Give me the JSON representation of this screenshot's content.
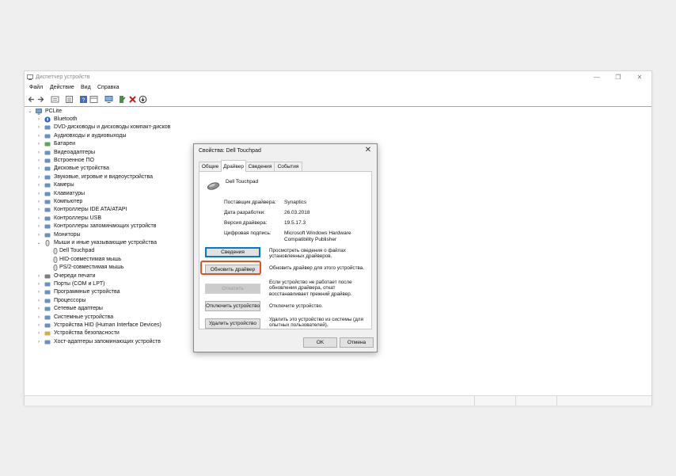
{
  "window": {
    "title": "Диспетчер устройств",
    "controls": {
      "minimize": "—",
      "maximize": "❐",
      "close": "✕"
    }
  },
  "menu": [
    "Файл",
    "Действие",
    "Вид",
    "Справка"
  ],
  "toolbar": [
    "back-icon",
    "forward-icon",
    "properties-icon",
    "list-icon",
    "help-icon",
    "view-icon",
    "monitor-icon",
    "update-driver-icon",
    "uninstall-icon",
    "download-icon"
  ],
  "tree": {
    "root": "PCLite",
    "items": [
      {
        "label": "Bluetooth",
        "icon": "bluetooth-icon"
      },
      {
        "label": "DVD-дисководы и дисководы компакт-дисков",
        "icon": "dvd-icon"
      },
      {
        "label": "Аудиовходы и аудиовыходы",
        "icon": "audio-icon"
      },
      {
        "label": "Батареи",
        "icon": "battery-icon"
      },
      {
        "label": "Видеоадаптеры",
        "icon": "display-adapter-icon"
      },
      {
        "label": "Встроенное ПО",
        "icon": "firmware-icon"
      },
      {
        "label": "Дисковые устройства",
        "icon": "disk-icon"
      },
      {
        "label": "Звуковые, игровые и видеоустройства",
        "icon": "sound-icon"
      },
      {
        "label": "Камеры",
        "icon": "camera-icon"
      },
      {
        "label": "Клавиатуры",
        "icon": "keyboard-icon"
      },
      {
        "label": "Компьютер",
        "icon": "computer-icon"
      },
      {
        "label": "Контроллеры IDE ATA/ATAPI",
        "icon": "ide-icon"
      },
      {
        "label": "Контроллеры USB",
        "icon": "usb-icon"
      },
      {
        "label": "Контроллеры запоминающих устройств",
        "icon": "storage-controller-icon"
      },
      {
        "label": "Мониторы",
        "icon": "monitor-icon"
      },
      {
        "label": "Мыши и иные указывающие устройства",
        "icon": "mouse-icon",
        "expanded": true
      },
      {
        "label": "Dell Touchpad",
        "icon": "mouse-icon",
        "child": true
      },
      {
        "label": "HID-совместимая мышь",
        "icon": "mouse-icon",
        "child": true
      },
      {
        "label": "PS/2-совместимая мышь",
        "icon": "mouse-icon",
        "child": true
      },
      {
        "label": "Очереди печати",
        "icon": "printer-icon"
      },
      {
        "label": "Порты (COM и LPT)",
        "icon": "port-icon"
      },
      {
        "label": "Программные устройства",
        "icon": "software-device-icon"
      },
      {
        "label": "Процессоры",
        "icon": "processor-icon"
      },
      {
        "label": "Сетевые адаптеры",
        "icon": "network-icon"
      },
      {
        "label": "Системные устройства",
        "icon": "system-icon"
      },
      {
        "label": "Устройства HID (Human Interface Devices)",
        "icon": "hid-icon"
      },
      {
        "label": "Устройства безопасности",
        "icon": "security-icon"
      },
      {
        "label": "Хост-адаптеры запоминающих устройств",
        "icon": "host-adapter-icon"
      }
    ]
  },
  "dialog": {
    "title": "Свойства: Dell Touchpad",
    "tabs": [
      "Общие",
      "Драйвер",
      "Сведения",
      "События"
    ],
    "active_tab": "Драйвер",
    "device_name": "Dell Touchpad",
    "props": [
      {
        "key": "Поставщик драйвера:",
        "value": "Synaptics"
      },
      {
        "key": "Дата разработки:",
        "value": "26.03.2018"
      },
      {
        "key": "Версия драйвера:",
        "value": "19.5.17.3"
      },
      {
        "key": "Цифровая подпись:",
        "value": "Microsoft Windows Hardware Compatibility Publisher"
      }
    ],
    "actions": [
      {
        "button": "Сведения",
        "desc": "Просмотреть сведения о файлах установленных драйверов."
      },
      {
        "button": "Обновить драйвер",
        "desc": "Обновить драйвер для этого устройства."
      },
      {
        "button": "Откатить",
        "desc": "Если устройство не работает после обновления драйвера, откат восстанавливает прежний драйвер."
      },
      {
        "button": "Отключить устройство",
        "desc": "Отключите устройство."
      },
      {
        "button": "Удалить устройство",
        "desc": "Удалить это устройство из системы (для опытных пользователей)."
      }
    ],
    "ok": "OK",
    "cancel": "Отмена"
  },
  "colors": {
    "highlight": "#e0531f",
    "focus": "#0078d7",
    "folder": "#4a7fb5"
  }
}
